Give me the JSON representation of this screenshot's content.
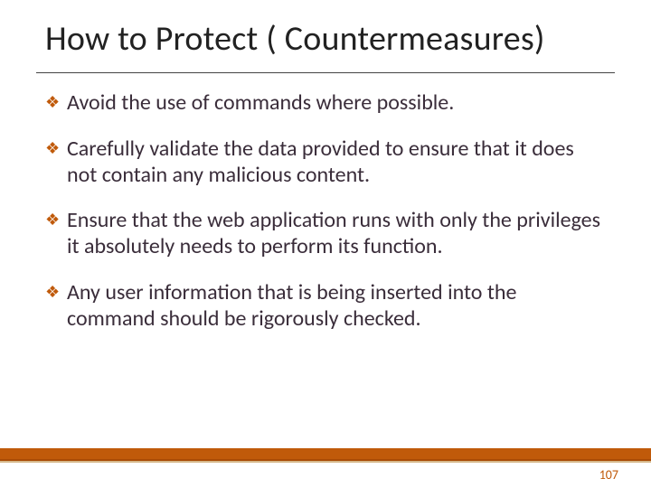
{
  "title": "How to Protect ( Countermeasures)",
  "bullets": [
    "Avoid the use of commands where possible.",
    "Carefully validate the data provided to ensure that it does not contain any malicious content.",
    "Ensure that the web application runs with only the privileges it absolutely needs to perform its function.",
    "Any user information that is being inserted into the command should be rigorously checked."
  ],
  "page_number": "107",
  "bullet_glyph": "❖"
}
